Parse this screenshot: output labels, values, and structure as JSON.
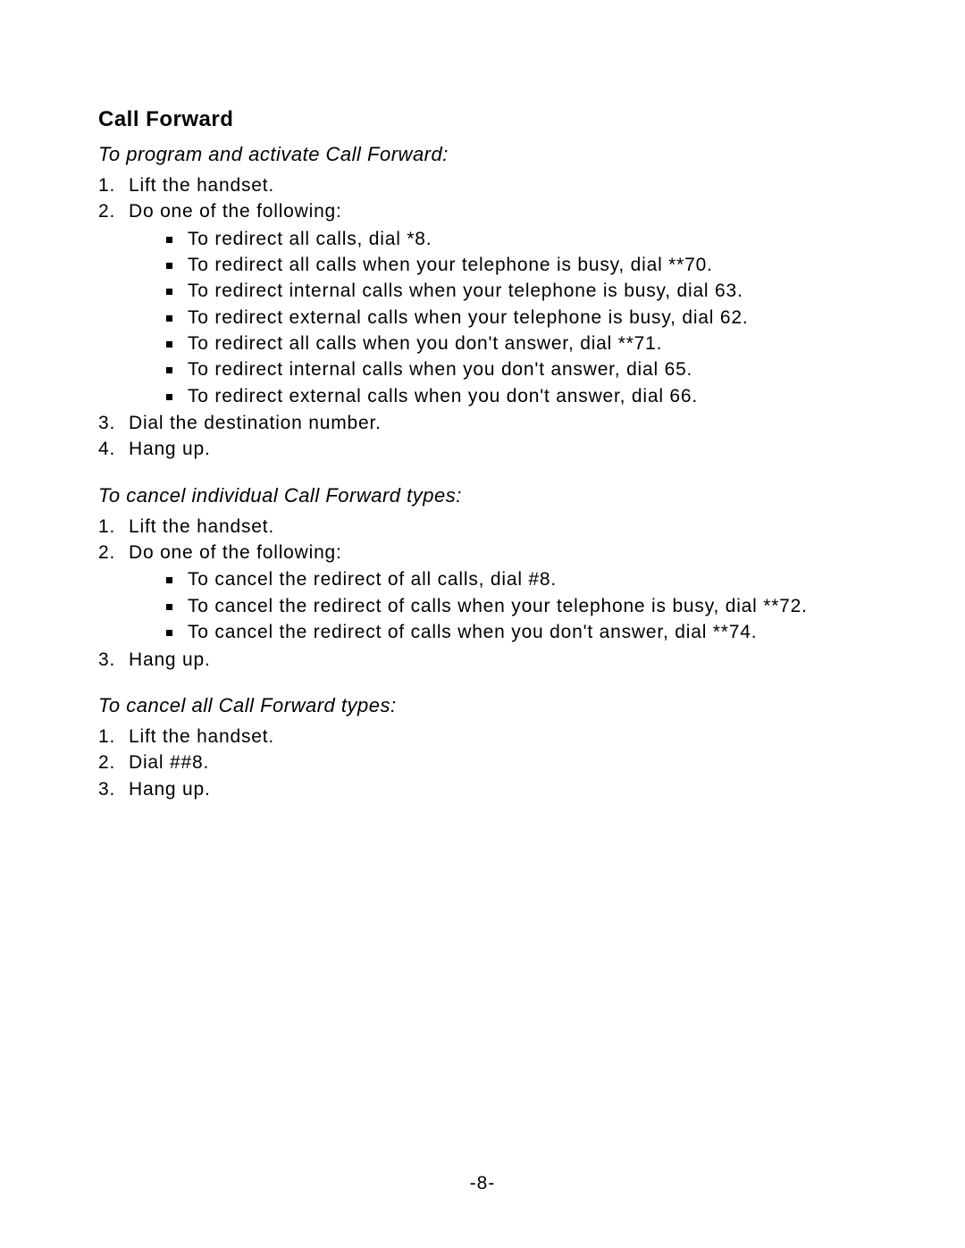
{
  "section": {
    "title": "Call Forward",
    "subsections": [
      {
        "title": "To program and activate Call Forward:",
        "steps": [
          {
            "num": "1.",
            "text": "Lift the handset."
          },
          {
            "num": "2.",
            "text": "Do one of the following:",
            "bullets": [
              "To redirect all calls, dial *8.",
              "To redirect all calls when your telephone is busy, dial **70.",
              "To redirect internal calls when your telephone is busy, dial 63.",
              "To redirect external calls when your telephone is busy, dial 62.",
              "To redirect all calls when you don't answer, dial **71.",
              "To redirect internal calls when you don't answer, dial 65.",
              "To redirect external calls when you don't answer, dial 66."
            ]
          },
          {
            "num": "3.",
            "text": "Dial the destination number."
          },
          {
            "num": "4.",
            "text": "Hang up."
          }
        ]
      },
      {
        "title": "To cancel individual Call Forward types:",
        "steps": [
          {
            "num": "1.",
            "text": "Lift the handset."
          },
          {
            "num": "2.",
            "text": "Do one of the following:",
            "bullets": [
              "To cancel the redirect of all calls, dial #8.",
              "To cancel the redirect of calls when your telephone is busy, dial **72.",
              "To cancel the redirect of calls when you don't answer, dial **74."
            ]
          },
          {
            "num": "3.",
            "text": "Hang up."
          }
        ]
      },
      {
        "title": "To cancel all Call Forward types:",
        "steps": [
          {
            "num": "1.",
            "text": "Lift the handset."
          },
          {
            "num": "2.",
            "text": "Dial ##8."
          },
          {
            "num": "3.",
            "text": "Hang up."
          }
        ]
      }
    ]
  },
  "page_number": "-8-"
}
